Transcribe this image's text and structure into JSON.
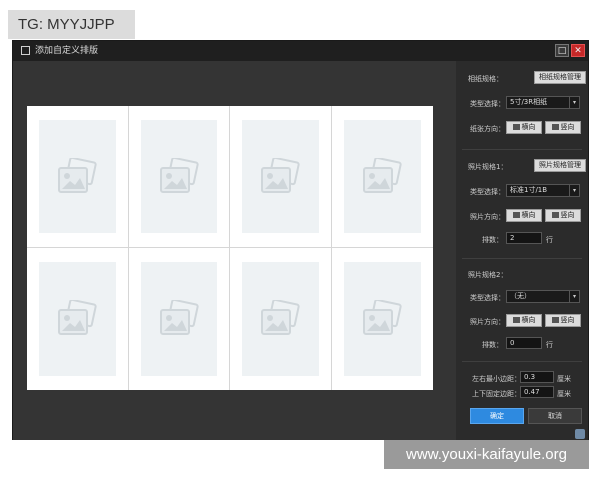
{
  "overlay_tag": "TG: MYYJJPP",
  "watermark": "www.youxi-kaifayule.org",
  "window": {
    "title": "添加自定义排版",
    "max_glyph": "□",
    "close_glyph": "✕"
  },
  "canvas": {
    "placeholders": 8
  },
  "panel": {
    "paper_spec_label": "相纸规格：",
    "paper_spec_manage": "相纸规格管理",
    "type_label_1": "类型选择：",
    "paper_type_value": "5寸/3R相纸",
    "paper_dir_label": "纸张方向：",
    "paper_dir_landscape": "横向",
    "paper_dir_portrait": "竖向",
    "photo_spec1_label": "照片规格1：",
    "photo_spec_manage": "照片规格管理",
    "type_label_2": "类型选择：",
    "photo1_type_value": "标准1寸/1B",
    "photo1_dir_label": "照片方向：",
    "photo1_dir_landscape": "横向",
    "photo1_dir_portrait": "竖向",
    "rows1_label": "排数：",
    "rows1_value": "2",
    "rows1_unit": "行",
    "photo_spec2_label": "照片规格2：",
    "type_label_3": "类型选择：",
    "photo2_type_value": "（无）",
    "photo2_dir_label": "照片方向：",
    "photo2_dir_landscape": "横向",
    "photo2_dir_portrait": "竖向",
    "rows2_label": "排数：",
    "rows2_value": "0",
    "rows2_unit": "行",
    "lr_margin_label": "左右最小边距：",
    "lr_margin_value": "0.3",
    "lr_margin_unit": "厘米",
    "tb_margin_label": "上下固定边距：",
    "tb_margin_value": "0.47",
    "tb_margin_unit": "厘米",
    "ok": "确定",
    "cancel": "取消"
  },
  "colors": {
    "accent": "#2e8ae0",
    "close": "#c62828",
    "window_bg": "#2b2b2b"
  }
}
